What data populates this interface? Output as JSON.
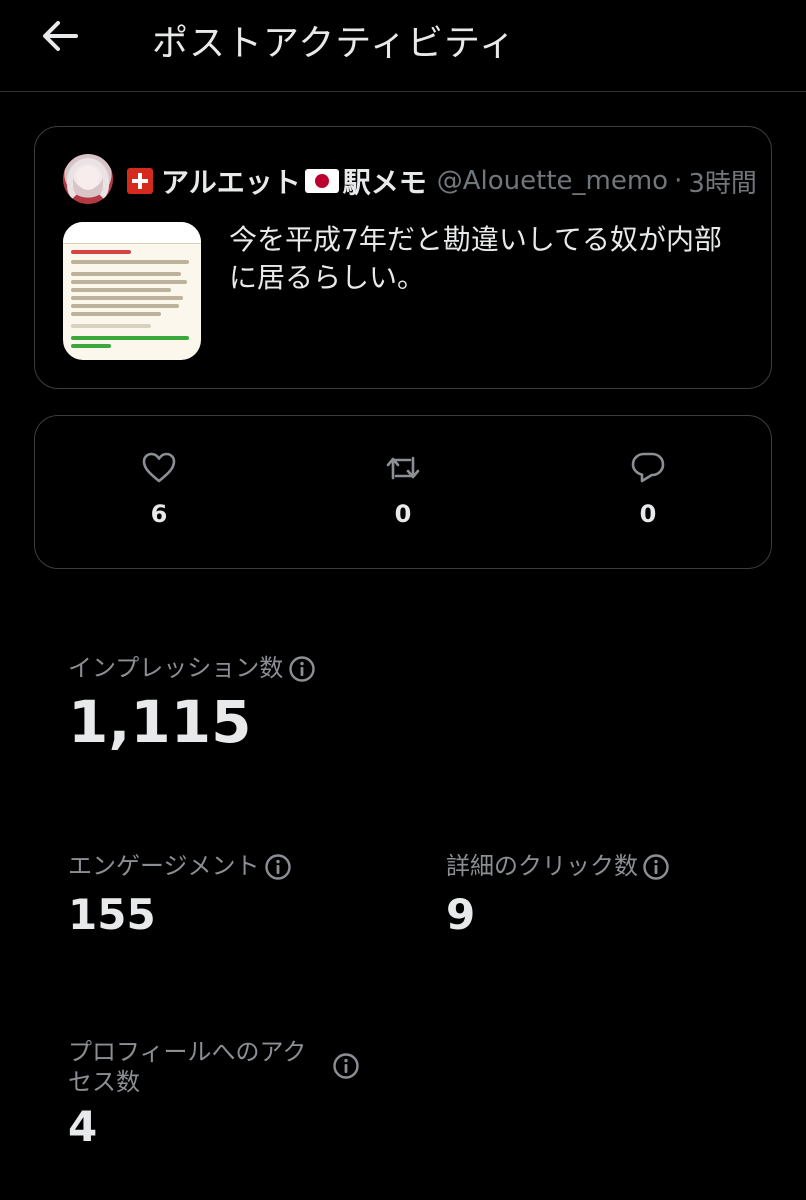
{
  "header": {
    "title": "ポストアクティビティ"
  },
  "post": {
    "author_name_part1": "アルエット",
    "author_name_part2": "駅メモ",
    "handle": "@Alouette_memo",
    "separator": "·",
    "time": "3時間",
    "text": "今を平成7年だと勘違いしてる奴が内部に居るらしい。"
  },
  "engagement": {
    "likes": "6",
    "reposts": "0",
    "replies": "0"
  },
  "metrics": {
    "impressions_label": "インプレッション数",
    "impressions_value": "1,115",
    "engagements_label": "エンゲージメント",
    "engagements_value": "155",
    "detail_clicks_label": "詳細のクリック数",
    "detail_clicks_value": "9",
    "profile_visits_label_line1": "プロフィールへのアク",
    "profile_visits_label_line2": "セス数",
    "profile_visits_value": "4"
  },
  "icons": {
    "back": "arrow-left-icon",
    "like": "heart-icon",
    "repost": "repost-icon",
    "reply": "speech-bubble-icon",
    "info": "info-icon"
  },
  "colors": {
    "background": "#000000",
    "text": "#e7e9ea",
    "muted": "#8b8f94",
    "border": "#3a3d41"
  }
}
